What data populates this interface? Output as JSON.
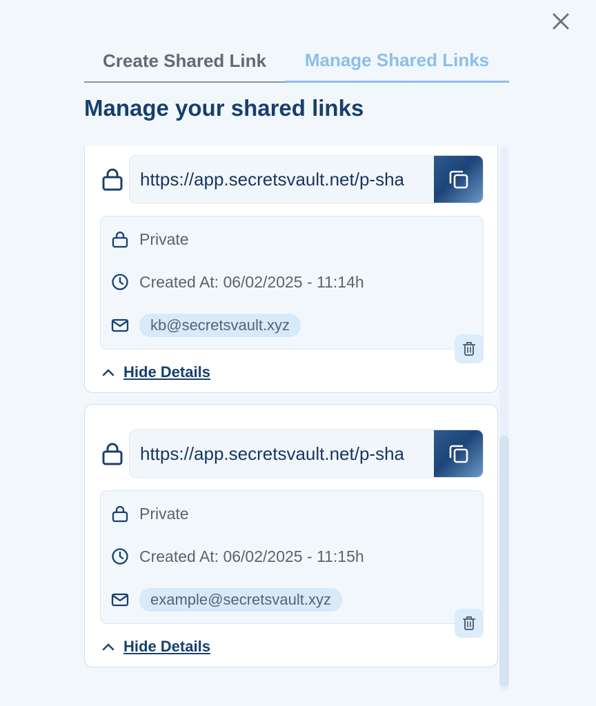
{
  "tabs": [
    {
      "label": "Create Shared Link",
      "active": false
    },
    {
      "label": "Manage Shared Links",
      "active": true
    }
  ],
  "title": "Manage your shared links",
  "links": [
    {
      "url": "https://app.secretsvault.net/p-sha",
      "visibility": "Private",
      "created": "Created At: 06/02/2025 - 11:14h",
      "email": "kb@secretsvault.xyz",
      "toggle_label": "Hide Details"
    },
    {
      "url": "https://app.secretsvault.net/p-sha",
      "visibility": "Private",
      "created": "Created At: 06/02/2025 - 11:15h",
      "email": "example@secretsvault.xyz",
      "toggle_label": "Hide Details"
    }
  ],
  "icons": {
    "close": "close-icon",
    "lock": "lock-icon",
    "copy": "copy-icon",
    "clock": "clock-icon",
    "mail": "mail-icon",
    "chevron": "chevron-up-icon",
    "trash": "trash-icon"
  },
  "colors": {
    "background": "#f2f7fc",
    "active_tab": "#8cbfea",
    "title": "#163f6e",
    "copy_button": "#1d4478"
  }
}
